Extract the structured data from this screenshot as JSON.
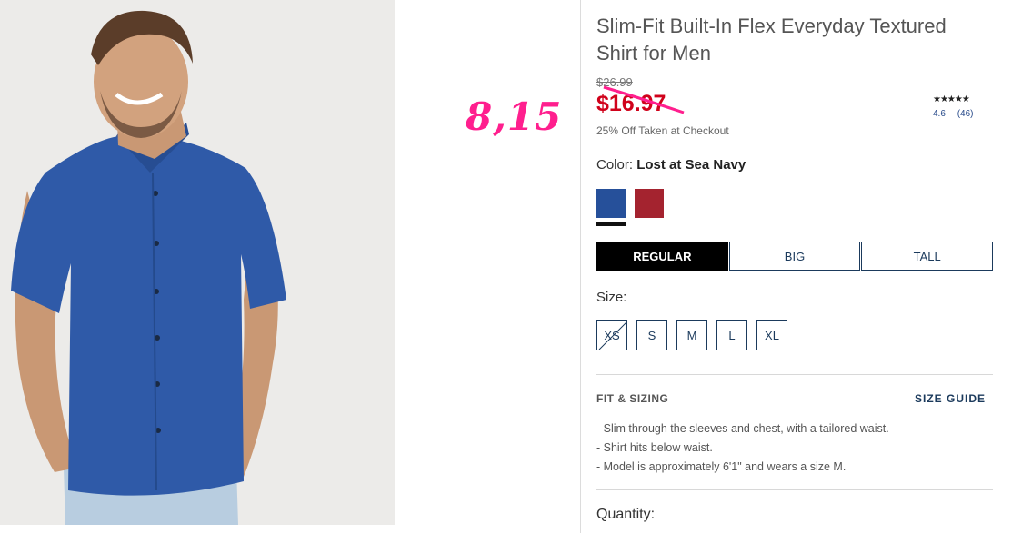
{
  "product": {
    "title": "Slim-Fit Built-In Flex Everyday Textured Shirt for Men",
    "original_price": "$26.99",
    "sale_price": "$16.97",
    "discount_note": "25% Off Taken at Checkout",
    "annotation": "8,15",
    "rating": {
      "stars": "★★★★★",
      "score": "4.6",
      "count": "(46)"
    }
  },
  "color": {
    "label": "Color:",
    "selected": "Lost at Sea Navy",
    "swatches": [
      {
        "name": "navy",
        "hex": "#26509a"
      },
      {
        "name": "red",
        "hex": "#a4232f"
      }
    ]
  },
  "fit": {
    "tabs": [
      "REGULAR",
      "BIG",
      "TALL"
    ],
    "active": "REGULAR"
  },
  "size": {
    "label": "Size:",
    "options": [
      "XS",
      "S",
      "M",
      "L",
      "XL"
    ],
    "unavailable": [
      "XS"
    ]
  },
  "fit_sizing": {
    "heading": "FIT & SIZING",
    "guide_link": "SIZE GUIDE",
    "bullets": [
      "Slim through the sleeves and chest, with a tailored waist.",
      "Shirt hits below waist.",
      "Model is approximately 6'1\" and wears a size M."
    ]
  },
  "quantity": {
    "label": "Quantity:"
  },
  "colors": {
    "accent": "#1b3a5c",
    "sale": "#d0021b",
    "annotation": "#ff1f8e"
  }
}
